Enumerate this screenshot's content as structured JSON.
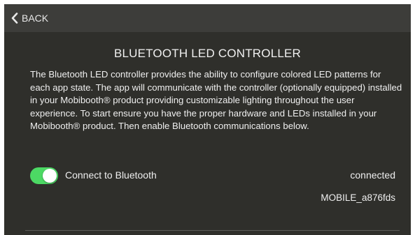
{
  "header": {
    "back_label": "BACK",
    "back_icon": "chevron-left-icon"
  },
  "main": {
    "title": "BLUETOOTH LED CONTROLLER",
    "description": "The Bluetooth LED controller provides the ability to configure colored LED patterns for each app state. The app will communicate with the controller (optionally equipped) installed in your Mobibooth® product providing customizable lighting throughout the user experience. To start ensure you have the proper hardware and LEDs installed in your Mobibooth® product. Then enable Bluetooth communications below.",
    "bluetooth_toggle": {
      "label": "Connect to Bluetooth",
      "on": true,
      "color": "#4cd964"
    },
    "connection_status": "connected",
    "device_name": "MOBILE_a876fds"
  },
  "colors": {
    "background": "#2f2f2b",
    "header": "#3d3d3a",
    "text": "#efefef"
  }
}
